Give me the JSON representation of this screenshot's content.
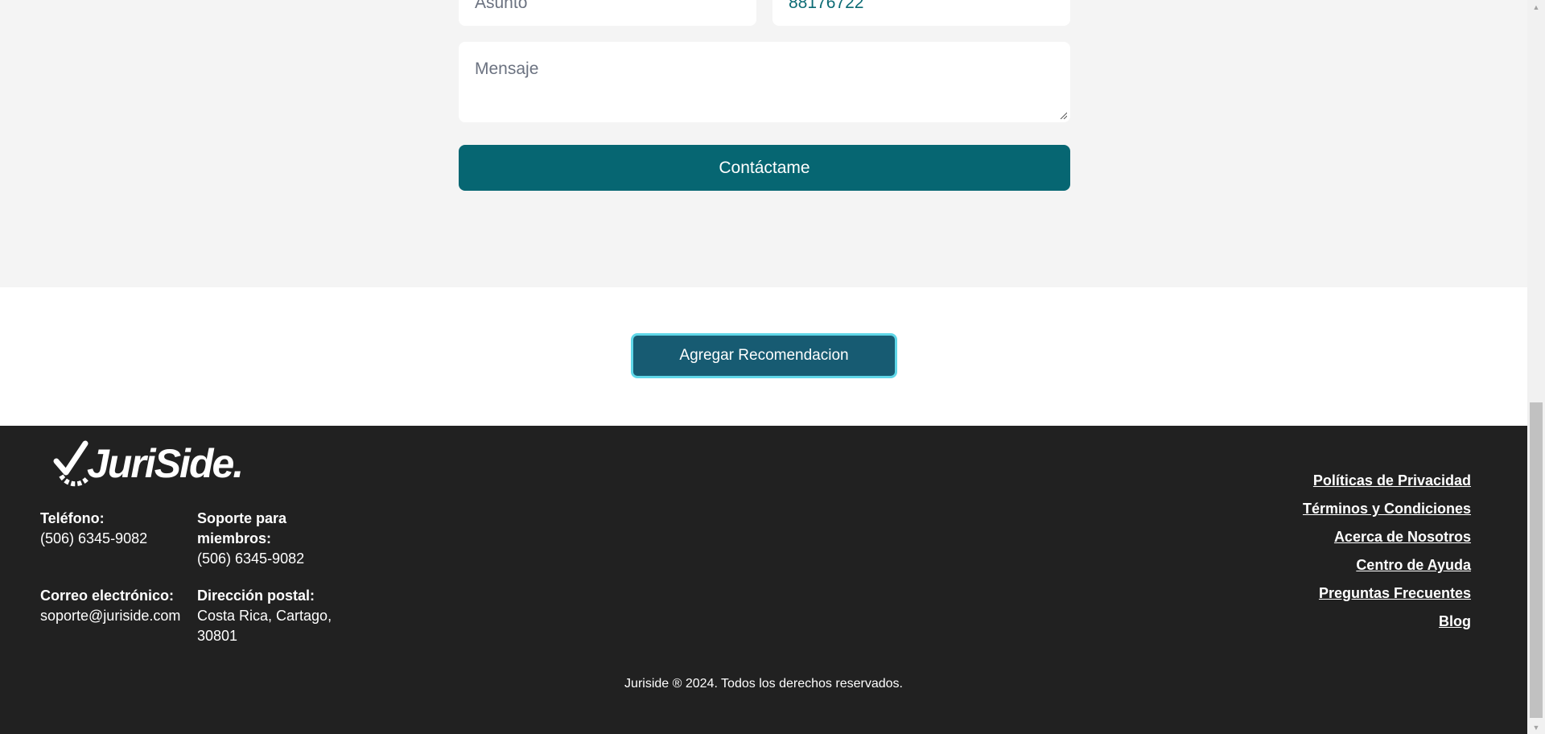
{
  "contact_form": {
    "subject_placeholder": "Asunto",
    "phone_value": "88176722",
    "message_placeholder": "Mensaje",
    "submit_label": "Contáctame"
  },
  "recommendation": {
    "button_label": "Agregar Recomendacion"
  },
  "footer": {
    "logo_text": "JuriSide.",
    "phone": {
      "label": "Teléfono:",
      "value": "(506) 6345-9082"
    },
    "support": {
      "label": "Soporte para miembros:",
      "value": "(506) 6345-9082"
    },
    "email": {
      "label": "Correo electrónico:",
      "value": "soporte@juriside.com"
    },
    "postal": {
      "label": "Dirección postal:",
      "value": "Costa Rica, Cartago, 30801"
    },
    "links": [
      "Políticas de Privacidad",
      "Términos y Condiciones",
      "Acerca de Nosotros",
      "Centro de Ayuda",
      "Preguntas Frecuentes",
      "Blog"
    ],
    "copyright": "Juriside ® 2024. Todos los derechos reservados."
  },
  "colors": {
    "accent": "#066672",
    "reco_button": "#175b72",
    "footer_bg": "#212121"
  }
}
